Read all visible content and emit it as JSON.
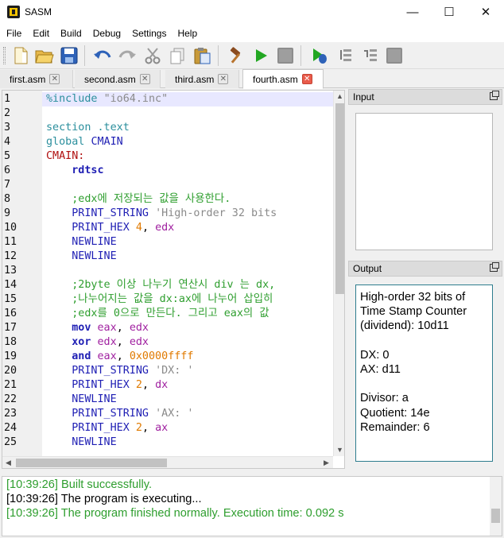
{
  "window": {
    "title": "SASM",
    "minimize": "—",
    "maximize": "☐",
    "close": "✕"
  },
  "menu": [
    "File",
    "Edit",
    "Build",
    "Debug",
    "Settings",
    "Help"
  ],
  "toolbar": {
    "icons": [
      "new-file-icon",
      "open-folder-icon",
      "save-icon",
      "undo-icon",
      "redo-icon",
      "cut-icon",
      "copy-icon",
      "paste-icon",
      "build-hammer-icon",
      "run-icon",
      "stop-icon",
      "debug-icon",
      "step-over-icon",
      "step-into-icon",
      "debug-stop-icon"
    ]
  },
  "tabs": [
    {
      "label": "first.asm",
      "active": false
    },
    {
      "label": "second.asm",
      "active": false
    },
    {
      "label": "third.asm",
      "active": false
    },
    {
      "label": "fourth.asm",
      "active": true
    }
  ],
  "editor": {
    "line_numbers": [
      "1",
      "2",
      "3",
      "4",
      "5",
      "6",
      "7",
      "8",
      "9",
      "10",
      "11",
      "12",
      "13",
      "14",
      "15",
      "16",
      "17",
      "18",
      "19",
      "20",
      "21",
      "22",
      "23",
      "24",
      "25"
    ],
    "lines": [
      [
        {
          "t": "%include ",
          "c": "#2b8f9d"
        },
        {
          "t": "\"io64.inc\"",
          "c": "#8a8a8a"
        }
      ],
      [],
      [
        {
          "t": "section .text",
          "c": "#2b8f9d"
        }
      ],
      [
        {
          "t": "global ",
          "c": "#2b8f9d"
        },
        {
          "t": "CMAIN",
          "c": "#1f1fb4"
        }
      ],
      [
        {
          "t": "CMAIN:",
          "c": "#b01010"
        }
      ],
      [
        {
          "t": "    rdtsc",
          "c": "#1f1fb4",
          "b": true
        }
      ],
      [],
      [
        {
          "t": "    ;edx에 저장되는 값을 사용한다.",
          "c": "#2e9e2e"
        }
      ],
      [
        {
          "t": "    PRINT_STRING ",
          "c": "#1f1fb4"
        },
        {
          "t": "'High-order 32 bits",
          "c": "#8a8a8a"
        }
      ],
      [
        {
          "t": "    PRINT_HEX ",
          "c": "#1f1fb4"
        },
        {
          "t": "4",
          "c": "#e07a00"
        },
        {
          "t": ", ",
          "c": "#000000"
        },
        {
          "t": "edx",
          "c": "#a020a0"
        }
      ],
      [
        {
          "t": "    NEWLINE",
          "c": "#1f1fb4"
        }
      ],
      [
        {
          "t": "    NEWLINE",
          "c": "#1f1fb4"
        }
      ],
      [],
      [
        {
          "t": "    ;2byte 이상 나누기 연산시 div 는 dx,",
          "c": "#2e9e2e"
        }
      ],
      [
        {
          "t": "    ;나누어지는 값을 dx:ax에 나누어 삽입히",
          "c": "#2e9e2e"
        }
      ],
      [
        {
          "t": "    ;edx를 0으로 만든다. 그리고 eax의 값",
          "c": "#2e9e2e"
        }
      ],
      [
        {
          "t": "    mov ",
          "c": "#1f1fb4",
          "b": true
        },
        {
          "t": "eax",
          "c": "#a020a0"
        },
        {
          "t": ", ",
          "c": "#000000"
        },
        {
          "t": "edx",
          "c": "#a020a0"
        }
      ],
      [
        {
          "t": "    xor ",
          "c": "#1f1fb4",
          "b": true
        },
        {
          "t": "edx",
          "c": "#a020a0"
        },
        {
          "t": ", ",
          "c": "#000000"
        },
        {
          "t": "edx",
          "c": "#a020a0"
        }
      ],
      [
        {
          "t": "    and ",
          "c": "#1f1fb4",
          "b": true
        },
        {
          "t": "eax",
          "c": "#a020a0"
        },
        {
          "t": ", ",
          "c": "#000000"
        },
        {
          "t": "0x0000ffff",
          "c": "#e07a00"
        }
      ],
      [
        {
          "t": "    PRINT_STRING ",
          "c": "#1f1fb4"
        },
        {
          "t": "'DX: '",
          "c": "#8a8a8a"
        }
      ],
      [
        {
          "t": "    PRINT_HEX ",
          "c": "#1f1fb4"
        },
        {
          "t": "2",
          "c": "#e07a00"
        },
        {
          "t": ", ",
          "c": "#000000"
        },
        {
          "t": "dx",
          "c": "#a020a0"
        }
      ],
      [
        {
          "t": "    NEWLINE",
          "c": "#1f1fb4"
        }
      ],
      [
        {
          "t": "    PRINT_STRING ",
          "c": "#1f1fb4"
        },
        {
          "t": "'AX: '",
          "c": "#8a8a8a"
        }
      ],
      [
        {
          "t": "    PRINT_HEX ",
          "c": "#1f1fb4"
        },
        {
          "t": "2",
          "c": "#e07a00"
        },
        {
          "t": ", ",
          "c": "#000000"
        },
        {
          "t": "ax",
          "c": "#a020a0"
        }
      ],
      [
        {
          "t": "    NEWLINE",
          "c": "#1f1fb4"
        }
      ]
    ]
  },
  "input_panel": {
    "title": "Input",
    "value": ""
  },
  "output_panel": {
    "title": "Output",
    "lines": [
      "High-order 32 bits of",
      "Time Stamp Counter",
      "(dividend): 10d11",
      "",
      "DX: 0",
      "AX: d11",
      "",
      "Divisor: a",
      "Quotient: 14e",
      "Remainder: 6"
    ]
  },
  "log": [
    {
      "text": "[10:39:26] Built successfully.",
      "color": "#2e9e2e"
    },
    {
      "text": "[10:39:26] The program is executing...",
      "color": "#000000"
    },
    {
      "text": "[10:39:26] The program finished normally. Execution time: 0.092 s",
      "color": "#2e9e2e"
    }
  ]
}
